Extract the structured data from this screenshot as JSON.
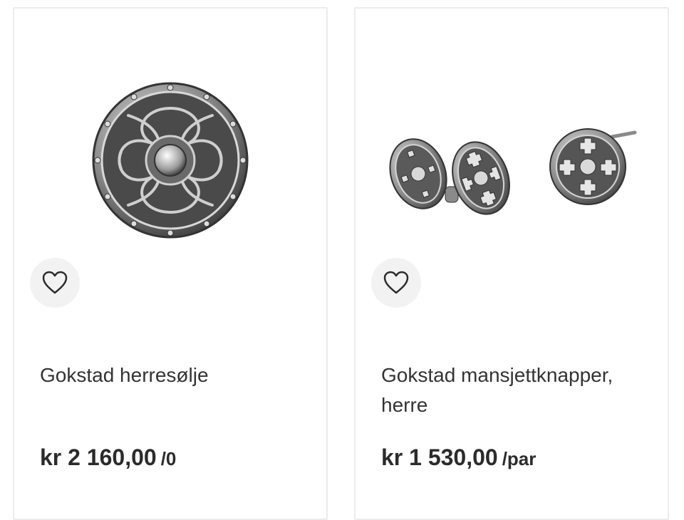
{
  "products": [
    {
      "title": "Gokstad herresølje",
      "price": "kr 2 160,00",
      "unit": "/0",
      "image": "round-silver-brooch",
      "favorite_icon": "heart-outline-icon"
    },
    {
      "title": "Gokstad mansjettknapper, herre",
      "price": "kr 1 530,00",
      "unit": "/par",
      "image": "silver-cufflinks-pair",
      "favorite_icon": "heart-outline-icon"
    }
  ],
  "colors": {
    "card_border": "#ececec",
    "favorite_bg": "#f2f2f2",
    "text": "#2b2b2b"
  }
}
